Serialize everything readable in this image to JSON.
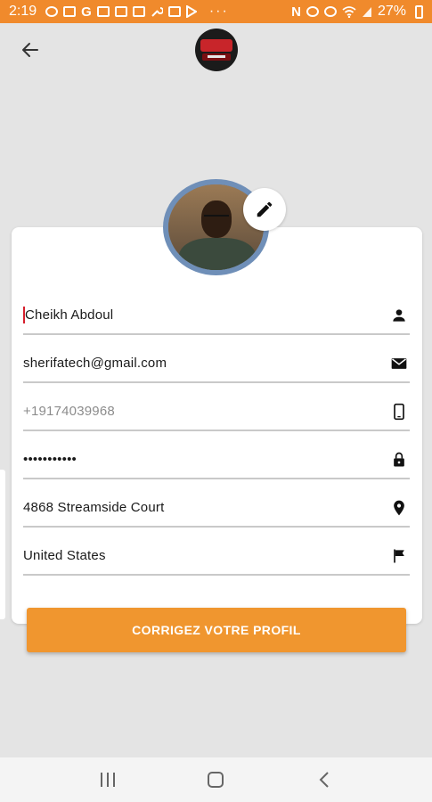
{
  "status_bar": {
    "time": "2:19",
    "battery": "27%",
    "icons": [
      "cat-icon",
      "app-icon",
      "google-icon",
      "image-icon",
      "mail-icon",
      "mail-icon",
      "wrench-icon",
      "mail-icon",
      "play-icon",
      "nfc-icon",
      "vibrate-icon",
      "mute-icon",
      "wifi-icon",
      "signal-icon",
      "battery-icon"
    ],
    "overflow": "···",
    "google_letter": "G",
    "nfc_letter": "N"
  },
  "app_bar": {
    "back_icon": "back-arrow-icon",
    "logo_icon": "app-logo-icon"
  },
  "profile": {
    "avatar_icon": "profile-avatar",
    "edit_icon": "pencil-icon"
  },
  "form": {
    "name": {
      "value": "Cheikh Abdoul",
      "icon": "person-icon"
    },
    "email": {
      "value": "sherifatech@gmail.com",
      "icon": "email-icon"
    },
    "phone": {
      "placeholder": "+19174039968",
      "icon": "phone-icon"
    },
    "password": {
      "value": "•••••••••••",
      "icon": "lock-icon"
    },
    "address": {
      "value": "4868 Streamside Court",
      "icon": "location-icon"
    },
    "country": {
      "value": "United States",
      "icon": "flag-icon"
    }
  },
  "submit_button": {
    "label": "CORRIGEZ VOTRE PROFIL"
  },
  "colors": {
    "accent": "#f0962f",
    "status_bar": "#f08a2c",
    "background": "#e4e4e4",
    "cursor": "#d61f2c"
  },
  "nav_bar": {
    "buttons": [
      "recent-apps-icon",
      "home-icon",
      "back-icon"
    ]
  }
}
